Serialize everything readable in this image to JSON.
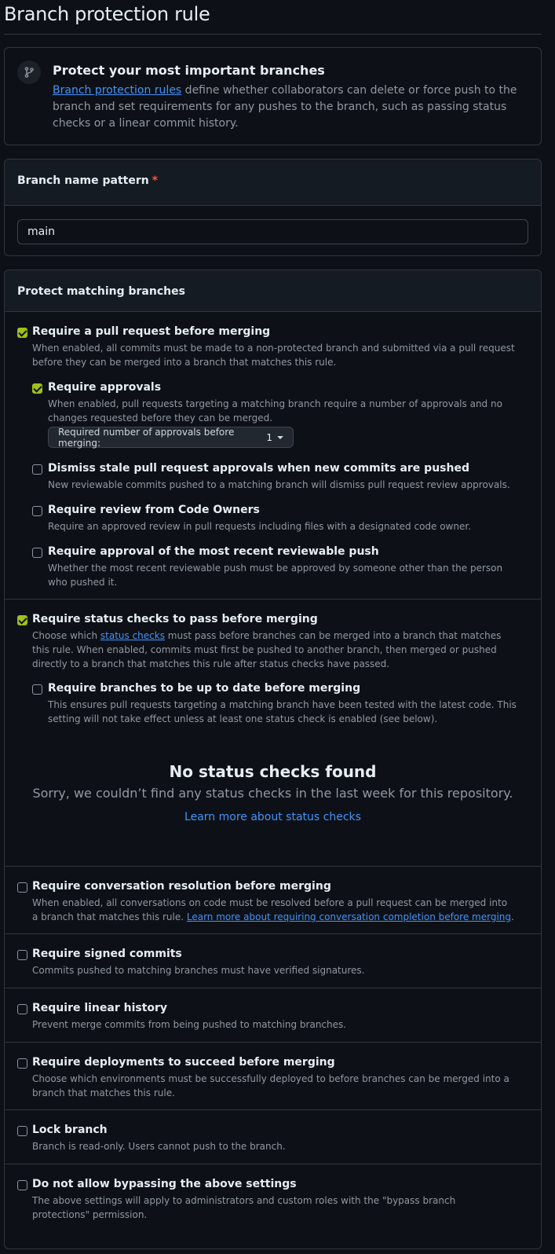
{
  "page": {
    "title": "Branch protection rule"
  },
  "intro": {
    "heading": "Protect your most important branches",
    "link_text": "Branch protection rules",
    "text_rest": " define whether collaborators can delete or force push to the branch and set requirements for any pushes to the branch, such as passing status checks or a linear commit history."
  },
  "pattern": {
    "label": "Branch name pattern",
    "required_mark": "*",
    "value": "main"
  },
  "protect": {
    "header": "Protect matching branches",
    "pr": {
      "title": "Require a pull request before merging",
      "desc": "When enabled, all commits must be made to a non-protected branch and submitted via a pull request before they can be merged into a branch that matches this rule.",
      "checked": true
    },
    "approvals": {
      "title": "Require approvals",
      "desc": "When enabled, pull requests targeting a matching branch require a number of approvals and no changes requested before they can be merged.",
      "checked": true,
      "select_label": "Required number of approvals before merging:",
      "select_value": "1"
    },
    "dismiss": {
      "title": "Dismiss stale pull request approvals when new commits are pushed",
      "desc": "New reviewable commits pushed to a matching branch will dismiss pull request review approvals.",
      "checked": false
    },
    "codeowners": {
      "title": "Require review from Code Owners",
      "desc": "Require an approved review in pull requests including files with a designated code owner.",
      "checked": false
    },
    "recent_push": {
      "title": "Require approval of the most recent reviewable push",
      "desc": "Whether the most recent reviewable push must be approved by someone other than the person who pushed it.",
      "checked": false
    },
    "status_checks": {
      "title": "Require status checks to pass before merging",
      "desc_before": "Choose which ",
      "desc_link": "status checks",
      "desc_after": " must pass before branches can be merged into a branch that matches this rule. When enabled, commits must first be pushed to another branch, then merged or pushed directly to a branch that matches this rule after status checks have passed.",
      "checked": true
    },
    "up_to_date": {
      "title": "Require branches to be up to date before merging",
      "desc": "This ensures pull requests targeting a matching branch have been tested with the latest code. This setting will not take effect unless at least one status check is enabled (see below).",
      "checked": false
    },
    "no_checks": {
      "title": "No status checks found",
      "text": "Sorry, we couldn’t find any status checks in the last week for this repository.",
      "link": "Learn more about status checks"
    },
    "conversation": {
      "title": "Require conversation resolution before merging",
      "desc_before": "When enabled, all conversations on code must be resolved before a pull request can be merged into a branch that matches this rule. ",
      "desc_link": "Learn more about requiring conversation completion before merging",
      "desc_after": ".",
      "checked": false
    },
    "signed": {
      "title": "Require signed commits",
      "desc": "Commits pushed to matching branches must have verified signatures.",
      "checked": false
    },
    "linear": {
      "title": "Require linear history",
      "desc": "Prevent merge commits from being pushed to matching branches.",
      "checked": false
    },
    "deployments": {
      "title": "Require deployments to succeed before merging",
      "desc": "Choose which environments must be successfully deployed to before branches can be merged into a branch that matches this rule.",
      "checked": false
    },
    "lock": {
      "title": "Lock branch",
      "desc": "Branch is read-only. Users cannot push to the branch.",
      "checked": false
    },
    "bypass": {
      "title": "Do not allow bypassing the above settings",
      "desc": "The above settings will apply to administrators and custom roles with the \"bypass branch protections\" permission.",
      "checked": false
    }
  }
}
